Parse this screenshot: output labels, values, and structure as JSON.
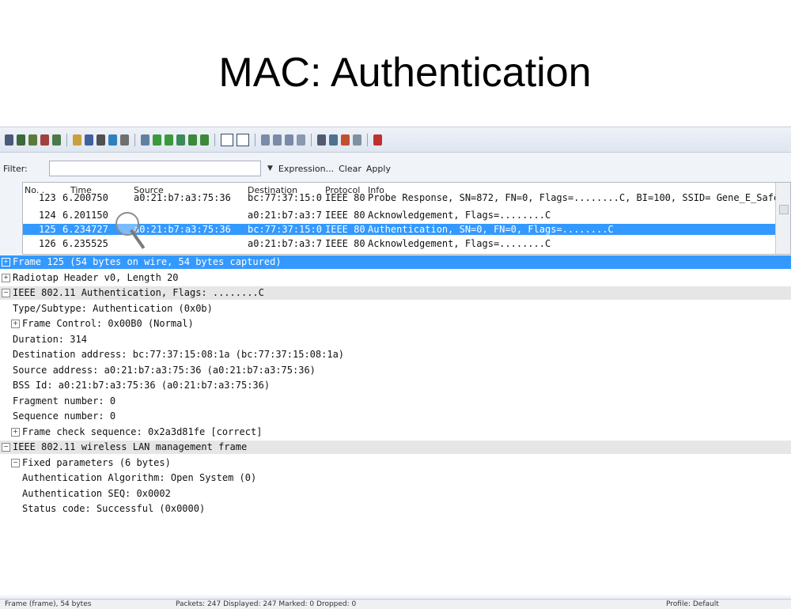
{
  "slide_title": "MAC: Authentication",
  "filter": {
    "label": "Filter:",
    "value": "",
    "expression_label": "Expression...",
    "clear_label": "Clear",
    "apply_label": "Apply"
  },
  "packet_list": {
    "columns": [
      "No. .",
      "Time",
      "Source",
      "Destination",
      "Protocol",
      "Info"
    ],
    "rows": [
      {
        "no": "123",
        "time": "6.200750",
        "source": "a0:21:b7:a3:75:36",
        "destination": "bc:77:37:15:0",
        "protocol": "IEEE 80",
        "info": "Probe Response, SN=872, FN=0, Flags=........C, BI=100, SSID= Gene_E_Safe"
      },
      {
        "no": "124",
        "time": "6.201150",
        "source": "",
        "destination": "a0:21:b7:a3:7",
        "protocol": "IEEE 80",
        "info": "Acknowledgement, Flags=........C"
      },
      {
        "no": "125",
        "time": "6.234727",
        "source": "a0:21:b7:a3:75:36",
        "destination": "bc:77:37:15:0",
        "protocol": "IEEE 80",
        "info": "Authentication, SN=0, FN=0, Flags=........C"
      },
      {
        "no": "126",
        "time": "6.235525",
        "source": "",
        "destination": "a0:21:b7:a3:7",
        "protocol": "IEEE 80",
        "info": "Acknowledgement, Flags=........C"
      }
    ]
  },
  "detail": [
    {
      "text": "Frame 125 (54 bytes on wire, 54 bytes captured)",
      "exp": "+",
      "style": "sel",
      "indent": 0
    },
    {
      "text": "Radiotap Header v0, Length 20",
      "exp": "+",
      "style": "",
      "indent": 0
    },
    {
      "text": "IEEE 802.11 Authentication, Flags: ........C",
      "exp": "−",
      "style": "sec",
      "indent": 0
    },
    {
      "text": "Type/Subtype: Authentication (0x0b)",
      "exp": "",
      "style": "",
      "indent": 1
    },
    {
      "text": "Frame Control: 0x00B0 (Normal)",
      "exp": "+",
      "style": "",
      "indent": 1
    },
    {
      "text": "Duration: 314",
      "exp": "",
      "style": "",
      "indent": 1
    },
    {
      "text": "Destination address: bc:77:37:15:08:1a (bc:77:37:15:08:1a)",
      "exp": "",
      "style": "",
      "indent": 1
    },
    {
      "text": "Source address: a0:21:b7:a3:75:36 (a0:21:b7:a3:75:36)",
      "exp": "",
      "style": "",
      "indent": 1
    },
    {
      "text": "BSS Id: a0:21:b7:a3:75:36 (a0:21:b7:a3:75:36)",
      "exp": "",
      "style": "",
      "indent": 1
    },
    {
      "text": "Fragment number: 0",
      "exp": "",
      "style": "",
      "indent": 1
    },
    {
      "text": "Sequence number: 0",
      "exp": "",
      "style": "",
      "indent": 1
    },
    {
      "text": "Frame check sequence: 0x2a3d81fe [correct]",
      "exp": "+",
      "style": "",
      "indent": 1
    },
    {
      "text": "IEEE 802.11 wireless LAN management frame",
      "exp": "−",
      "style": "sec",
      "indent": 0
    },
    {
      "text": "Fixed parameters (6 bytes)",
      "exp": "−",
      "style": "",
      "indent": 1
    },
    {
      "text": "Authentication Algorithm: Open System (0)",
      "exp": "",
      "style": "",
      "indent": 2
    },
    {
      "text": "Authentication SEQ: 0x0002",
      "exp": "",
      "style": "",
      "indent": 2
    },
    {
      "text": "Status code: Successful (0x0000)",
      "exp": "",
      "style": "",
      "indent": 2
    }
  ],
  "status": {
    "left": "Frame (frame), 54 bytes",
    "middle": "Packets: 247 Displayed: 247 Marked: 0 Dropped: 0",
    "right": "Profile: Default"
  },
  "colors": {
    "selection": "#3399ff",
    "section": "#e6e6e6"
  }
}
